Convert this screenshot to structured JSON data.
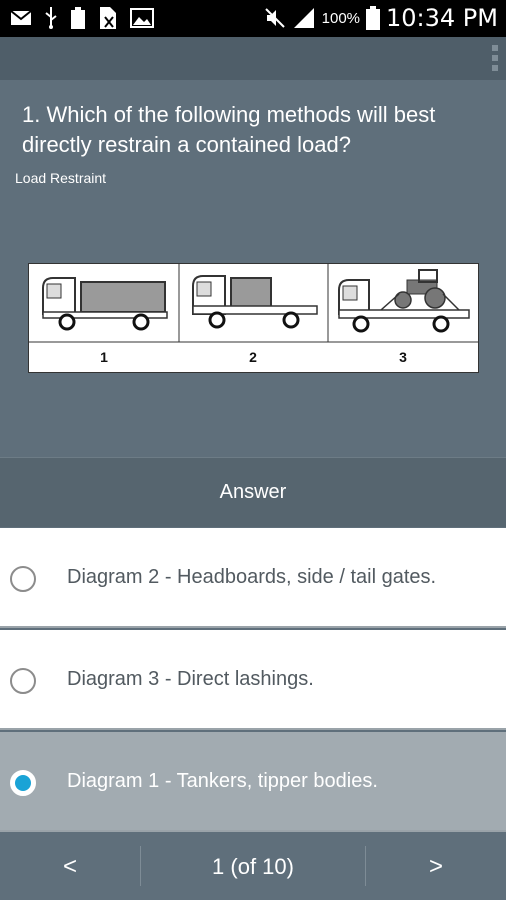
{
  "status_bar": {
    "battery_text": "100%",
    "time": "10:34 PM"
  },
  "question": {
    "text": "1. Which of the following methods will best directly restrain a contained load?",
    "category": "Load Restraint"
  },
  "diagram": {
    "labels": [
      "1",
      "2",
      "3"
    ]
  },
  "answer_header": "Answer",
  "options": [
    {
      "label": "Diagram 2 - Headboards, side / tail gates.",
      "selected": false
    },
    {
      "label": "Diagram 3 - Direct lashings.",
      "selected": false
    },
    {
      "label": "Diagram 1 - Tankers, tipper bodies.",
      "selected": true
    }
  ],
  "nav": {
    "prev": "<",
    "page": "1 (of 10)",
    "next": ">"
  },
  "colors": {
    "background": "#5f6f7b",
    "selected_radio": "#1aa3d6",
    "selected_row": "#a2abb1"
  }
}
